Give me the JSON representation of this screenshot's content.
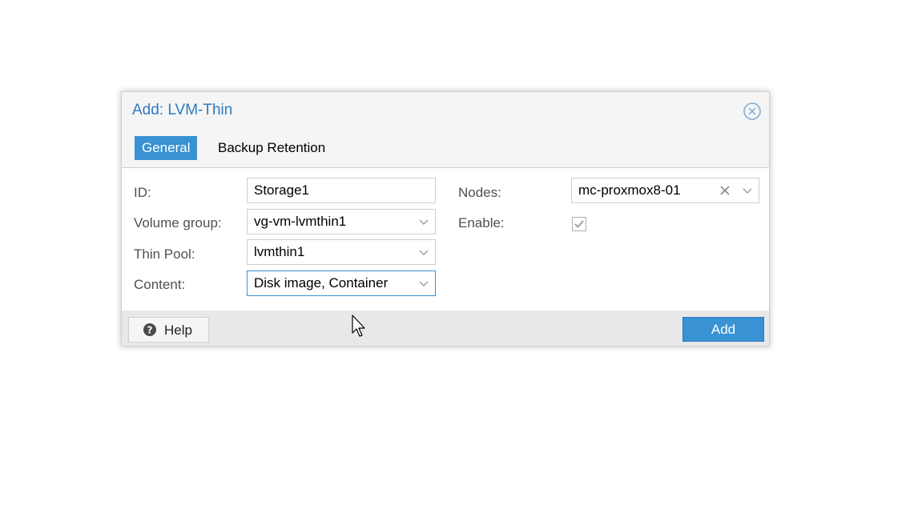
{
  "dialog": {
    "title": "Add: LVM-Thin",
    "close_icon": "close-circle-icon"
  },
  "tabs": [
    {
      "label": "General",
      "active": true
    },
    {
      "label": "Backup Retention",
      "active": false
    }
  ],
  "form": {
    "left": {
      "id": {
        "label": "ID:",
        "value": "Storage1"
      },
      "volume_group": {
        "label": "Volume group:",
        "value": "vg-vm-lvmthin1"
      },
      "thin_pool": {
        "label": "Thin Pool:",
        "value": "lvmthin1"
      },
      "content": {
        "label": "Content:",
        "value": "Disk image, Container"
      }
    },
    "right": {
      "nodes": {
        "label": "Nodes:",
        "value": "mc-proxmox8-01"
      },
      "enable": {
        "label": "Enable:",
        "checked": true
      }
    }
  },
  "footer": {
    "help_label": "Help",
    "add_label": "Add"
  },
  "colors": {
    "accent": "#3892d4",
    "title": "#2d7bc0",
    "panel_bg": "#f5f5f5",
    "footer_bg": "#e8e8e8"
  }
}
